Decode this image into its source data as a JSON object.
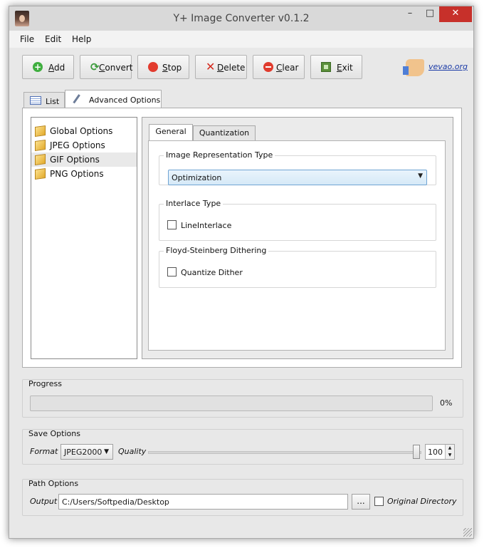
{
  "window": {
    "title": "Y+ Image Converter v0.1.2",
    "minimize": "–",
    "maximize": "□",
    "close": "✕"
  },
  "menu": [
    "File",
    "Edit",
    "Help"
  ],
  "toolbar": {
    "add": "Add",
    "convert": "Convert",
    "stop": "Stop",
    "delete": "Delete",
    "clear": "Clear",
    "exit": "Exit",
    "link": "vevao.org"
  },
  "tabs": {
    "list": "List",
    "advanced": "Advanced Options"
  },
  "tree": [
    "Global Options",
    "JPEG Options",
    "GIF Options",
    "PNG Options"
  ],
  "subtabs": {
    "general": "General",
    "quantization": "Quantization"
  },
  "general": {
    "representation_title": "Image Representation Type",
    "representation_value": "Optimization",
    "interlace_title": "Interlace Type",
    "interlace_option": "LineInterlace",
    "interlace_checked": false,
    "dither_title": "Floyd-Steinberg Dithering",
    "dither_option": "Quantize Dither",
    "dither_checked": false
  },
  "progress": {
    "title": "Progress",
    "value_percent": 0,
    "text": "0%"
  },
  "save": {
    "title": "Save Options",
    "format_label": "Format",
    "format_value": "JPEG2000",
    "quality_label": "Quality",
    "quality_value": "100"
  },
  "path": {
    "title": "Path Options",
    "output_label": "Output",
    "output_value": "C:/Users/Softpedia/Desktop",
    "browse_label": "...",
    "original_dir_label": "Original Directory",
    "original_dir_checked": false
  },
  "colors": {
    "accent": "#6fa4d4",
    "close": "#c7302a",
    "link": "#1a3aa6"
  }
}
